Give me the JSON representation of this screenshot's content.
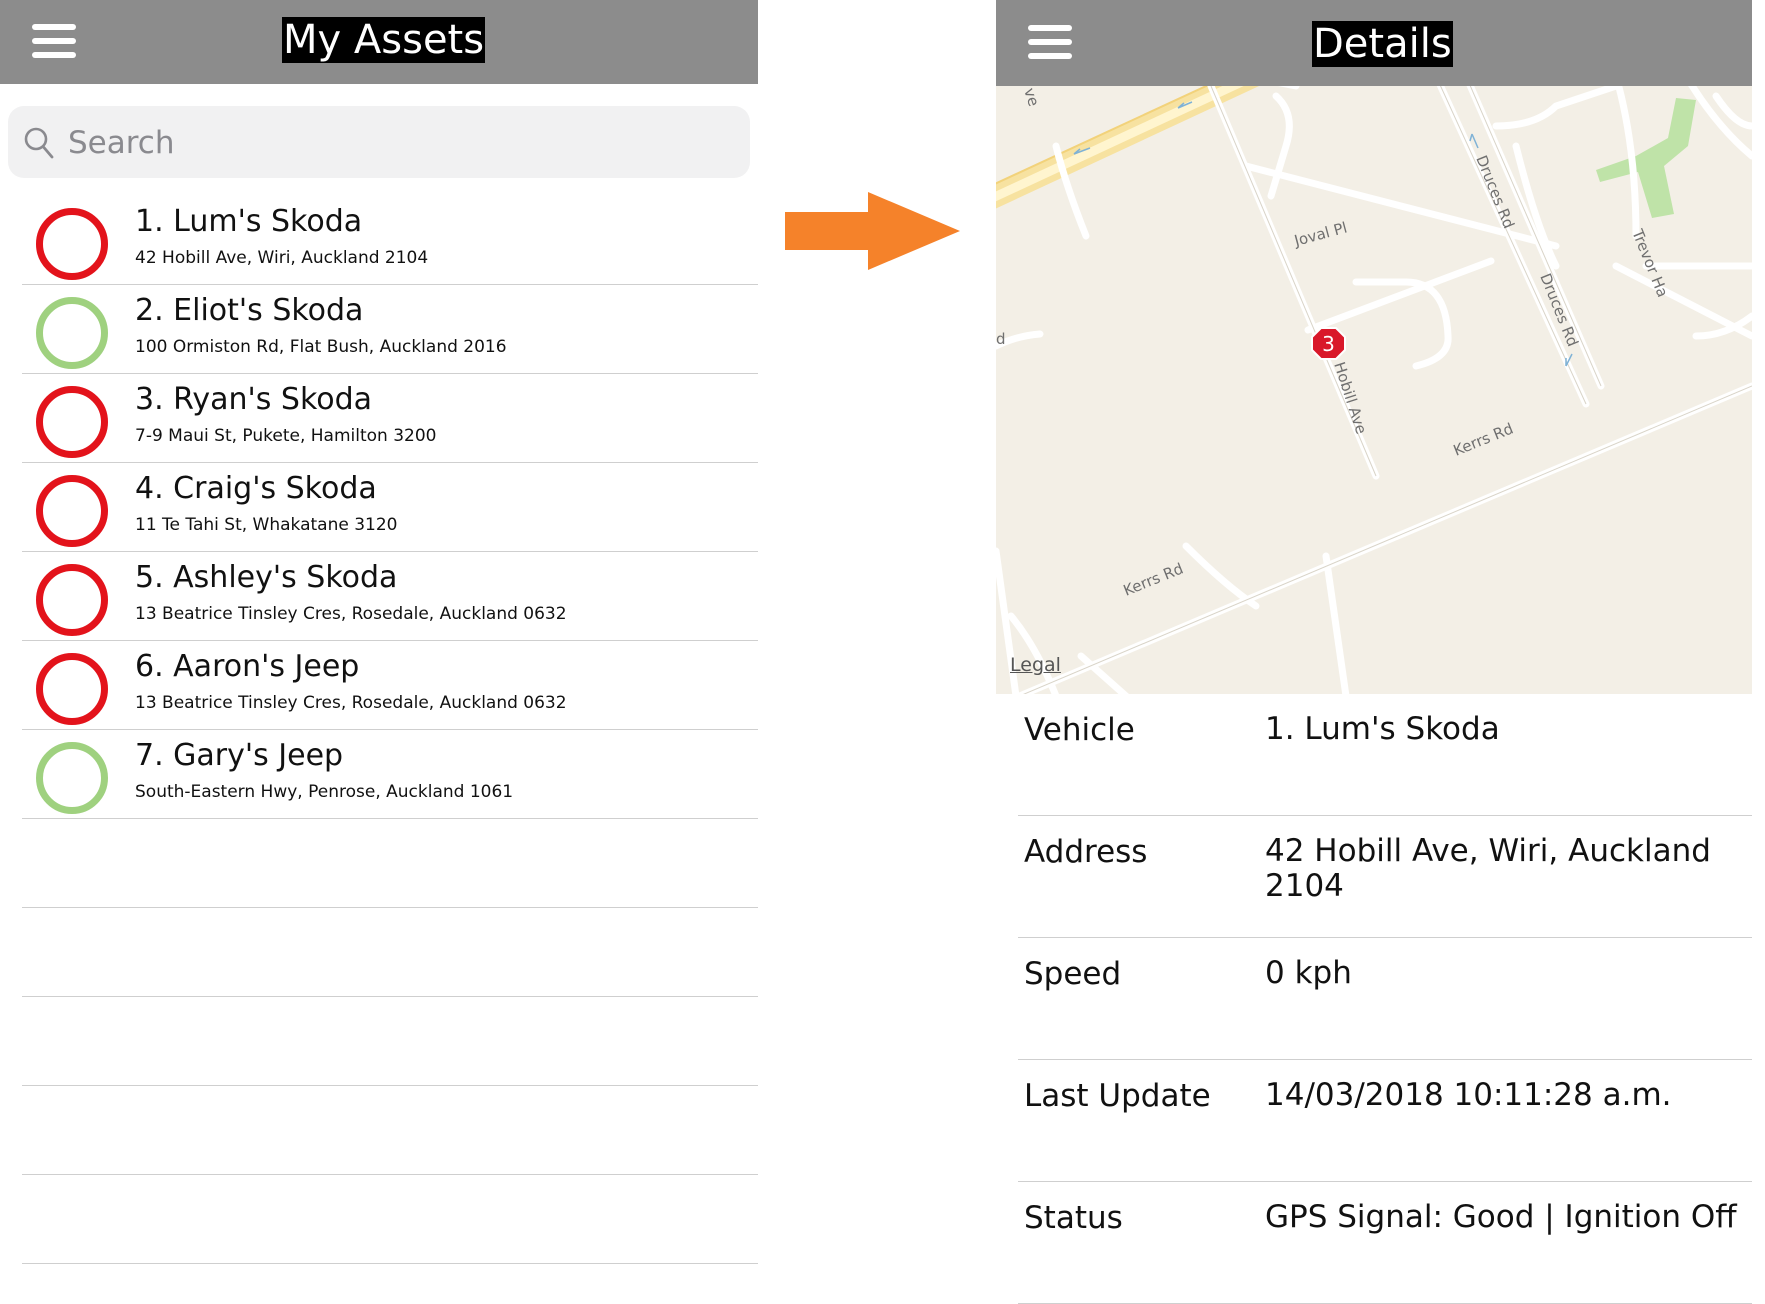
{
  "left_screen": {
    "title": "My Assets",
    "search": {
      "placeholder": "Search",
      "value": ""
    },
    "assets": [
      {
        "name": "1. Lum's Skoda",
        "address": "42 Hobill Ave, Wiri, Auckland 2104",
        "status": "off"
      },
      {
        "name": "2. Eliot's Skoda",
        "address": "100 Ormiston Rd, Flat Bush, Auckland 2016",
        "status": "on"
      },
      {
        "name": "3. Ryan's Skoda",
        "address": "7-9 Maui St, Pukete, Hamilton 3200",
        "status": "off"
      },
      {
        "name": "4. Craig's Skoda",
        "address": "11 Te Tahi St, Whakatane 3120",
        "status": "off"
      },
      {
        "name": "5. Ashley's Skoda",
        "address": "13 Beatrice Tinsley Cres, Rosedale, Auckland 0632",
        "status": "off"
      },
      {
        "name": "6. Aaron's Jeep",
        "address": "13 Beatrice Tinsley Cres, Rosedale, Auckland 0632",
        "status": "off"
      },
      {
        "name": "7. Gary's Jeep",
        "address": "South-Eastern Hwy, Penrose, Auckland 1061",
        "status": "on"
      }
    ]
  },
  "right_screen": {
    "title": "Details",
    "map": {
      "marker_label": "3",
      "legal_link": "Legal",
      "road_labels": {
        "joval": "Joval Pl",
        "druces_upper": "Druces Rd",
        "druces_lower": "Druces Rd",
        "trevor": "Trevor Ha",
        "hobill": "Hobill Ave",
        "kerrs_upper": "Kerrs Rd",
        "kerrs_lower": "Kerrs Rd",
        "edge_top": "ve",
        "edge_mid": "d"
      }
    },
    "details": [
      {
        "label": "Vehicle",
        "value": "1. Lum's Skoda"
      },
      {
        "label": "Address",
        "value": "42 Hobill Ave, Wiri, Auckland 2104"
      },
      {
        "label": "Speed",
        "value": "0 kph"
      },
      {
        "label": "Last Update",
        "value": "14/03/2018 10:11:28 a.m."
      },
      {
        "label": "Status",
        "value": "GPS Signal: Good | Ignition Off"
      }
    ]
  },
  "colors": {
    "topbar": "#8c8c8c",
    "status_off": "#e3131b",
    "status_on": "#9fd17f",
    "arrow": "#f5822a",
    "map_background": "#f3efe6",
    "marker": "#d9182a"
  },
  "icons": {
    "menu": "hamburger-menu-icon",
    "search": "magnifier-icon",
    "arrow": "right-arrow-icon",
    "marker": "map-pin-icon"
  }
}
